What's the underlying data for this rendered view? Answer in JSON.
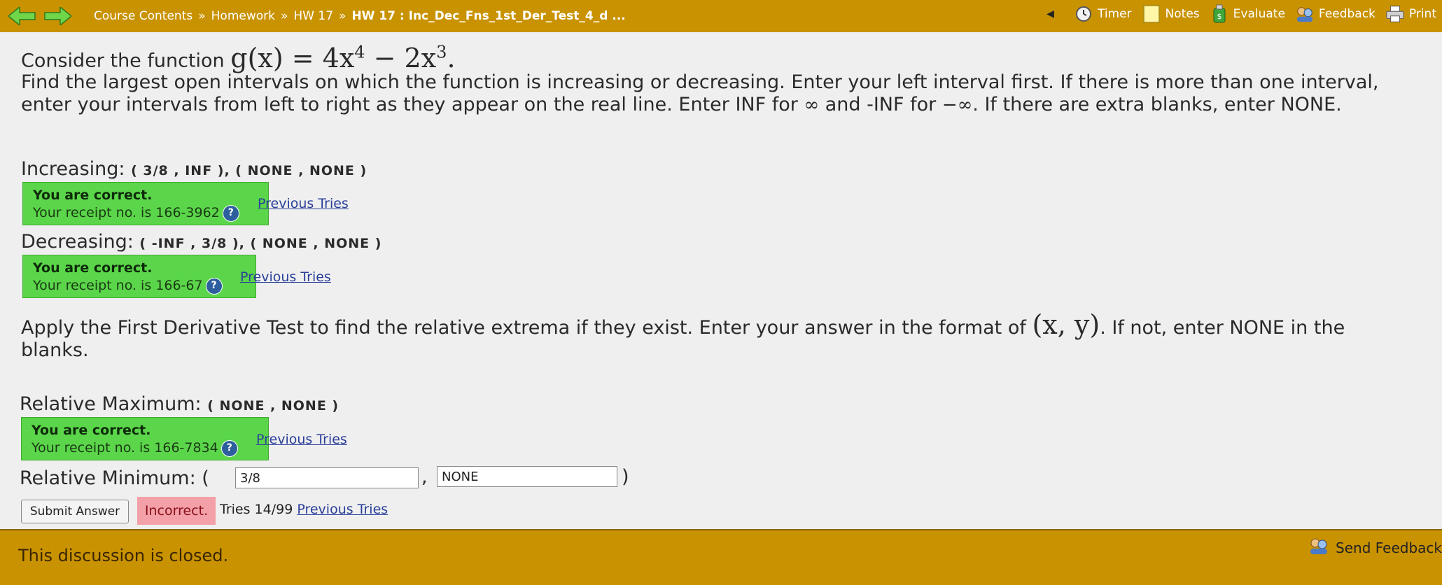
{
  "nav": {
    "breadcrumbs": [
      "Course Contents",
      "Homework",
      "HW 17"
    ],
    "separator": "»",
    "current": "HW 17 : Inc_Dec_Fns_1st_Der_Test_4_d ...",
    "tools": {
      "timer": "Timer",
      "notes": "Notes",
      "evaluate": "Evaluate",
      "feedback": "Feedback",
      "print": "Print"
    }
  },
  "problem": {
    "intro": "Consider the function",
    "function_expr": "g(x) = 4x",
    "exp1": "4",
    "minus": " − 2x",
    "exp2": "3",
    "period": ".",
    "instructions_1": "Find the largest open intervals on which the function is increasing or decreasing. Enter your left interval first. If there is more than one interval, enter your intervals from left to right as they appear on the real line. Enter INF for",
    "inf": "∞",
    "instructions_2": "and -INF for",
    "neg_inf": "−∞",
    "instructions_3": ". If there are extra blanks, enter NONE."
  },
  "increasing": {
    "label": "Increasing:",
    "answer": "( 3/8 , INF ), ( NONE , NONE )",
    "status_title": "You are correct.",
    "receipt": "Your receipt no. is 166-3962",
    "prev_tries": "Previous Tries"
  },
  "decreasing": {
    "label": "Decreasing:",
    "answer": "( -INF , 3/8 ), ( NONE , NONE )",
    "status_title": "You are correct.",
    "receipt": "Your receipt no. is 166-67",
    "prev_tries": "Previous Tries"
  },
  "part2": {
    "text_1": "Apply the First Derivative Test to find the relative extrema if they exist. Enter your answer in the format of",
    "format": "(x, y)",
    "text_2": ". If not, enter NONE in the blanks."
  },
  "rel_max": {
    "label": "Relative Maximum:",
    "answer": "( NONE , NONE )",
    "status_title": "You are correct.",
    "receipt": "Your receipt no. is 166-7834",
    "prev_tries": "Previous Tries"
  },
  "rel_min": {
    "label": "Relative Minimum: (",
    "x_value": "3/8",
    "comma": ",",
    "y_value": "NONE",
    "close": ")"
  },
  "submit": {
    "button": "Submit Answer",
    "status": "Incorrect.",
    "tries": "Tries 14/99",
    "prev_tries": "Previous Tries"
  },
  "footer": {
    "closed": "This discussion is closed.",
    "send_feedback": "Send Feedback"
  },
  "colors": {
    "bar": "#c99200",
    "correct": "#5bd64a",
    "incorrect": "#f3a0a8",
    "link": "#2a3f9a"
  }
}
